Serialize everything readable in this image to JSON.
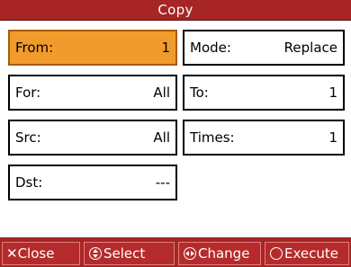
{
  "window": {
    "title": "Copy"
  },
  "fields": {
    "from": {
      "label": "From:",
      "value": "1"
    },
    "mode": {
      "label": "Mode:",
      "value": "Replace"
    },
    "for": {
      "label": "For:",
      "value": "All"
    },
    "to": {
      "label": "To:",
      "value": "1"
    },
    "src": {
      "label": "Src:",
      "value": "All"
    },
    "times": {
      "label": "Times:",
      "value": "1"
    },
    "dst": {
      "label": "Dst:",
      "value": "---"
    }
  },
  "footer": {
    "close": {
      "icon": "cross-icon",
      "label": "Close"
    },
    "select": {
      "icon": "up-down-dial-icon",
      "label": "Select"
    },
    "change": {
      "icon": "left-right-dial-icon",
      "label": "Change"
    },
    "execute": {
      "icon": "circle-icon",
      "label": "Execute"
    }
  },
  "colors": {
    "title_bar": "#a72525",
    "selected_field": "#f29b2d",
    "panel_background": "#ffffff",
    "field_border": "#000000"
  }
}
